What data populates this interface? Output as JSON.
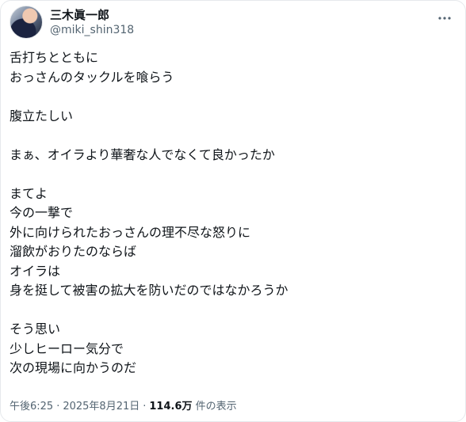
{
  "author": {
    "display_name": "三木眞一郎",
    "handle": "@miki_shin318"
  },
  "more_icon": "more-horizontal-icon",
  "body_lines": [
    "舌打ちとともに",
    "おっさんのタックルを喰らう",
    "",
    "腹立たしい",
    "",
    "まぁ、オイラより華奢な人でなくて良かったか",
    "",
    "まてよ",
    "今の一撃で",
    "外に向けられたおっさんの理不尽な怒りに",
    "溜飲がおりたのならば",
    "オイラは",
    "身を挺して被害の拡大を防いだのではなかろうか",
    "",
    "そう思い",
    "少しヒーロー気分で",
    "次の現場に向かうのだ"
  ],
  "meta": {
    "time": "午後6:25",
    "date": "2025年8月21日",
    "separator": "·",
    "views": "114.6万",
    "views_suffix": "件の表示"
  }
}
